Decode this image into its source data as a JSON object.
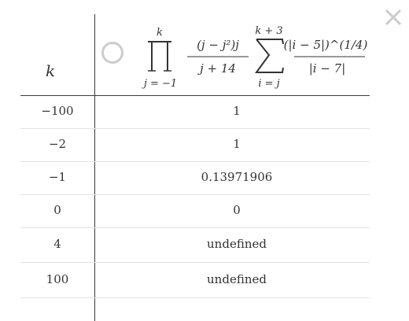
{
  "header": {
    "variable": "k",
    "formula": {
      "prod_upper": "k",
      "prod_lower": "j = −1",
      "frac1_num": "(j − j²)j",
      "frac1_den": "j + 14",
      "sum_upper": "k + 3",
      "sum_lower": "i = j",
      "frac2_num": "(|i − 5|)^(1/4)",
      "frac2_den": "|i − 7|"
    }
  },
  "rows": [
    {
      "k": "−100",
      "value": "1"
    },
    {
      "k": "−2",
      "value": "1"
    },
    {
      "k": "−1",
      "value": "0.13971906"
    },
    {
      "k": "0",
      "value": "0"
    },
    {
      "k": "4",
      "value": "undefined"
    },
    {
      "k": "100",
      "value": "undefined"
    }
  ],
  "icons": {
    "close": "close-icon",
    "radio": "radio-button-icon"
  },
  "colors": {
    "text": "#333333",
    "grid": "#3a3a3a",
    "row_divider": "#e3e3e3",
    "icon_gray": "#cccccc"
  }
}
